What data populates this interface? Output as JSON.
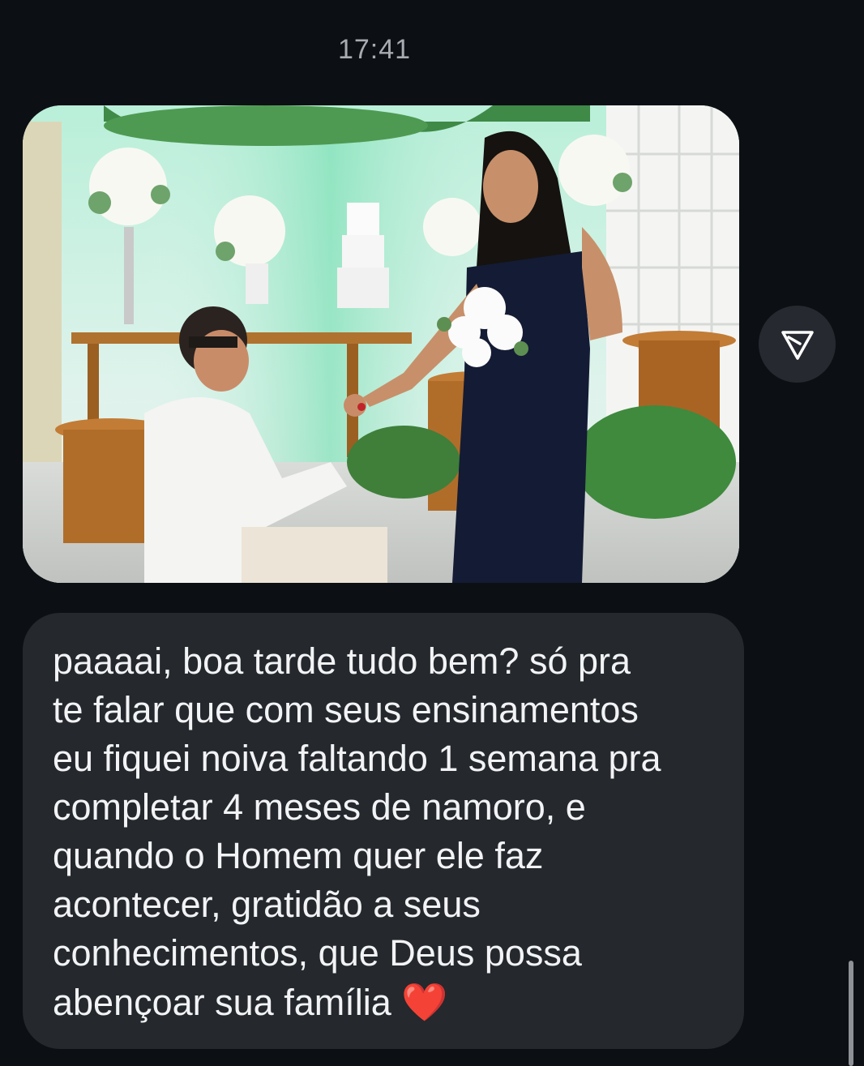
{
  "chat": {
    "timestamp": "17:41",
    "photo": {
      "description_icon": "photo-image"
    },
    "share_icon": "send-triangle-icon",
    "message_lines": [
      "paaaai, boa tarde tudo bem? só pra",
      "te falar que com seus ensinamentos",
      "eu fiquei noiva faltando 1 semana pra",
      "completar 4 meses de namoro, e",
      "quando o Homem quer ele faz",
      "acontecer, gratidão a seus",
      "conhecimentos, que Deus possa",
      "abençoar sua família"
    ],
    "emoji": "❤️"
  },
  "colors": {
    "background": "#0c1014",
    "bubble": "#25282d",
    "text": "#f2f3f5",
    "timestamp": "#a8acb2",
    "heart": "#e2202e"
  }
}
